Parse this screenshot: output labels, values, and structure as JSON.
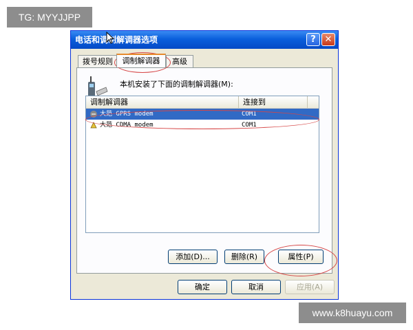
{
  "watermarks": {
    "top_left": "TG: MYYJJPP",
    "bottom_right": "www.k8huayu.com"
  },
  "dialog": {
    "title": "电话和调制解调器选项",
    "help_glyph": "?",
    "close_glyph": "✕",
    "tabs": [
      {
        "label": "拨号规则",
        "active": false
      },
      {
        "label": "调制解调器",
        "active": true
      },
      {
        "label": "高级",
        "active": false
      }
    ],
    "description": "本机安装了下面的调制解调器(M):",
    "list": {
      "columns": [
        "调制解调器",
        "连接到"
      ],
      "rows": [
        {
          "name": "大范 GPRS modem",
          "port": "COM1",
          "selected": true
        },
        {
          "name": "大范 CDMA modem",
          "port": "COM1",
          "selected": false
        }
      ]
    },
    "buttons": {
      "add": "添加(D)...",
      "delete": "删除(R)",
      "properties": "属性(P)"
    },
    "footer": {
      "ok": "确定",
      "cancel": "取消",
      "apply": "应用(A)"
    }
  },
  "colors": {
    "titlebar": "#0a5fdc",
    "selection": "#316ac5",
    "annotation": "#d64545"
  }
}
